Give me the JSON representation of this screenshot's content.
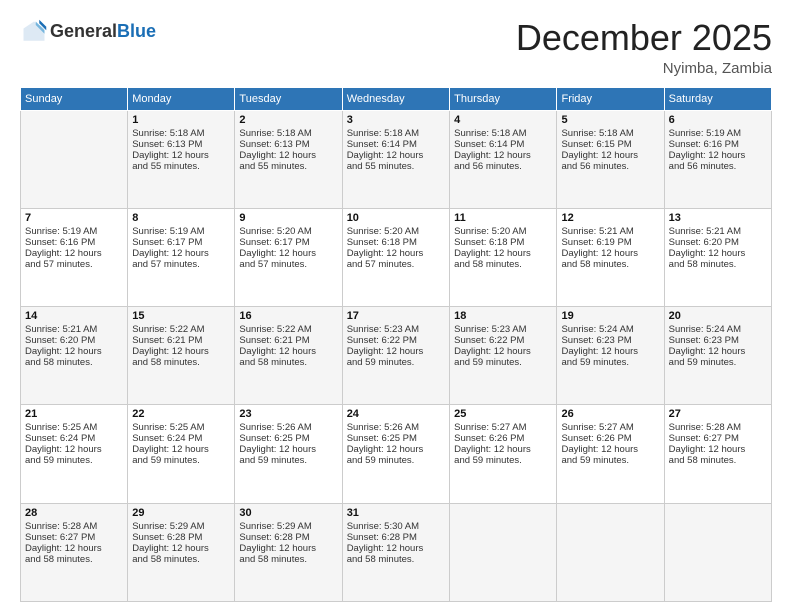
{
  "header": {
    "logo_line1": "General",
    "logo_line2": "Blue",
    "month": "December 2025",
    "location": "Nyimba, Zambia"
  },
  "days_of_week": [
    "Sunday",
    "Monday",
    "Tuesday",
    "Wednesday",
    "Thursday",
    "Friday",
    "Saturday"
  ],
  "weeks": [
    [
      {
        "day": "",
        "info": ""
      },
      {
        "day": "1",
        "info": "Sunrise: 5:18 AM\nSunset: 6:13 PM\nDaylight: 12 hours\nand 55 minutes."
      },
      {
        "day": "2",
        "info": "Sunrise: 5:18 AM\nSunset: 6:13 PM\nDaylight: 12 hours\nand 55 minutes."
      },
      {
        "day": "3",
        "info": "Sunrise: 5:18 AM\nSunset: 6:14 PM\nDaylight: 12 hours\nand 55 minutes."
      },
      {
        "day": "4",
        "info": "Sunrise: 5:18 AM\nSunset: 6:14 PM\nDaylight: 12 hours\nand 56 minutes."
      },
      {
        "day": "5",
        "info": "Sunrise: 5:18 AM\nSunset: 6:15 PM\nDaylight: 12 hours\nand 56 minutes."
      },
      {
        "day": "6",
        "info": "Sunrise: 5:19 AM\nSunset: 6:16 PM\nDaylight: 12 hours\nand 56 minutes."
      }
    ],
    [
      {
        "day": "7",
        "info": "Sunrise: 5:19 AM\nSunset: 6:16 PM\nDaylight: 12 hours\nand 57 minutes."
      },
      {
        "day": "8",
        "info": "Sunrise: 5:19 AM\nSunset: 6:17 PM\nDaylight: 12 hours\nand 57 minutes."
      },
      {
        "day": "9",
        "info": "Sunrise: 5:20 AM\nSunset: 6:17 PM\nDaylight: 12 hours\nand 57 minutes."
      },
      {
        "day": "10",
        "info": "Sunrise: 5:20 AM\nSunset: 6:18 PM\nDaylight: 12 hours\nand 57 minutes."
      },
      {
        "day": "11",
        "info": "Sunrise: 5:20 AM\nSunset: 6:18 PM\nDaylight: 12 hours\nand 58 minutes."
      },
      {
        "day": "12",
        "info": "Sunrise: 5:21 AM\nSunset: 6:19 PM\nDaylight: 12 hours\nand 58 minutes."
      },
      {
        "day": "13",
        "info": "Sunrise: 5:21 AM\nSunset: 6:20 PM\nDaylight: 12 hours\nand 58 minutes."
      }
    ],
    [
      {
        "day": "14",
        "info": "Sunrise: 5:21 AM\nSunset: 6:20 PM\nDaylight: 12 hours\nand 58 minutes."
      },
      {
        "day": "15",
        "info": "Sunrise: 5:22 AM\nSunset: 6:21 PM\nDaylight: 12 hours\nand 58 minutes."
      },
      {
        "day": "16",
        "info": "Sunrise: 5:22 AM\nSunset: 6:21 PM\nDaylight: 12 hours\nand 58 minutes."
      },
      {
        "day": "17",
        "info": "Sunrise: 5:23 AM\nSunset: 6:22 PM\nDaylight: 12 hours\nand 59 minutes."
      },
      {
        "day": "18",
        "info": "Sunrise: 5:23 AM\nSunset: 6:22 PM\nDaylight: 12 hours\nand 59 minutes."
      },
      {
        "day": "19",
        "info": "Sunrise: 5:24 AM\nSunset: 6:23 PM\nDaylight: 12 hours\nand 59 minutes."
      },
      {
        "day": "20",
        "info": "Sunrise: 5:24 AM\nSunset: 6:23 PM\nDaylight: 12 hours\nand 59 minutes."
      }
    ],
    [
      {
        "day": "21",
        "info": "Sunrise: 5:25 AM\nSunset: 6:24 PM\nDaylight: 12 hours\nand 59 minutes."
      },
      {
        "day": "22",
        "info": "Sunrise: 5:25 AM\nSunset: 6:24 PM\nDaylight: 12 hours\nand 59 minutes."
      },
      {
        "day": "23",
        "info": "Sunrise: 5:26 AM\nSunset: 6:25 PM\nDaylight: 12 hours\nand 59 minutes."
      },
      {
        "day": "24",
        "info": "Sunrise: 5:26 AM\nSunset: 6:25 PM\nDaylight: 12 hours\nand 59 minutes."
      },
      {
        "day": "25",
        "info": "Sunrise: 5:27 AM\nSunset: 6:26 PM\nDaylight: 12 hours\nand 59 minutes."
      },
      {
        "day": "26",
        "info": "Sunrise: 5:27 AM\nSunset: 6:26 PM\nDaylight: 12 hours\nand 59 minutes."
      },
      {
        "day": "27",
        "info": "Sunrise: 5:28 AM\nSunset: 6:27 PM\nDaylight: 12 hours\nand 58 minutes."
      }
    ],
    [
      {
        "day": "28",
        "info": "Sunrise: 5:28 AM\nSunset: 6:27 PM\nDaylight: 12 hours\nand 58 minutes."
      },
      {
        "day": "29",
        "info": "Sunrise: 5:29 AM\nSunset: 6:28 PM\nDaylight: 12 hours\nand 58 minutes."
      },
      {
        "day": "30",
        "info": "Sunrise: 5:29 AM\nSunset: 6:28 PM\nDaylight: 12 hours\nand 58 minutes."
      },
      {
        "day": "31",
        "info": "Sunrise: 5:30 AM\nSunset: 6:28 PM\nDaylight: 12 hours\nand 58 minutes."
      },
      {
        "day": "",
        "info": ""
      },
      {
        "day": "",
        "info": ""
      },
      {
        "day": "",
        "info": ""
      }
    ]
  ]
}
